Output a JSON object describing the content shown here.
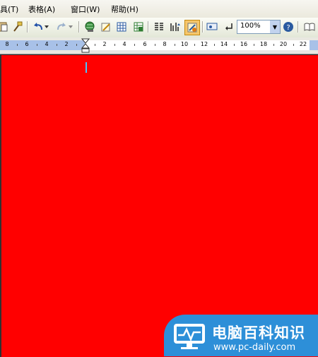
{
  "menu": [
    "具(T)",
    "表格(A)",
    "窗口(W)",
    "帮助(H)"
  ],
  "zoom": "100%",
  "ruler": [
    "8",
    "6",
    "4",
    "2",
    "2",
    "4",
    "6",
    "8",
    "10",
    "12",
    "14",
    "16",
    "18",
    "20",
    "22"
  ],
  "watermark": {
    "title": "电脑百科知识",
    "url": "www.pc-daily.com"
  },
  "colors": {
    "document": "#ff0000",
    "cursor": "#48c7ff",
    "watermark": "#2d8fd8"
  }
}
